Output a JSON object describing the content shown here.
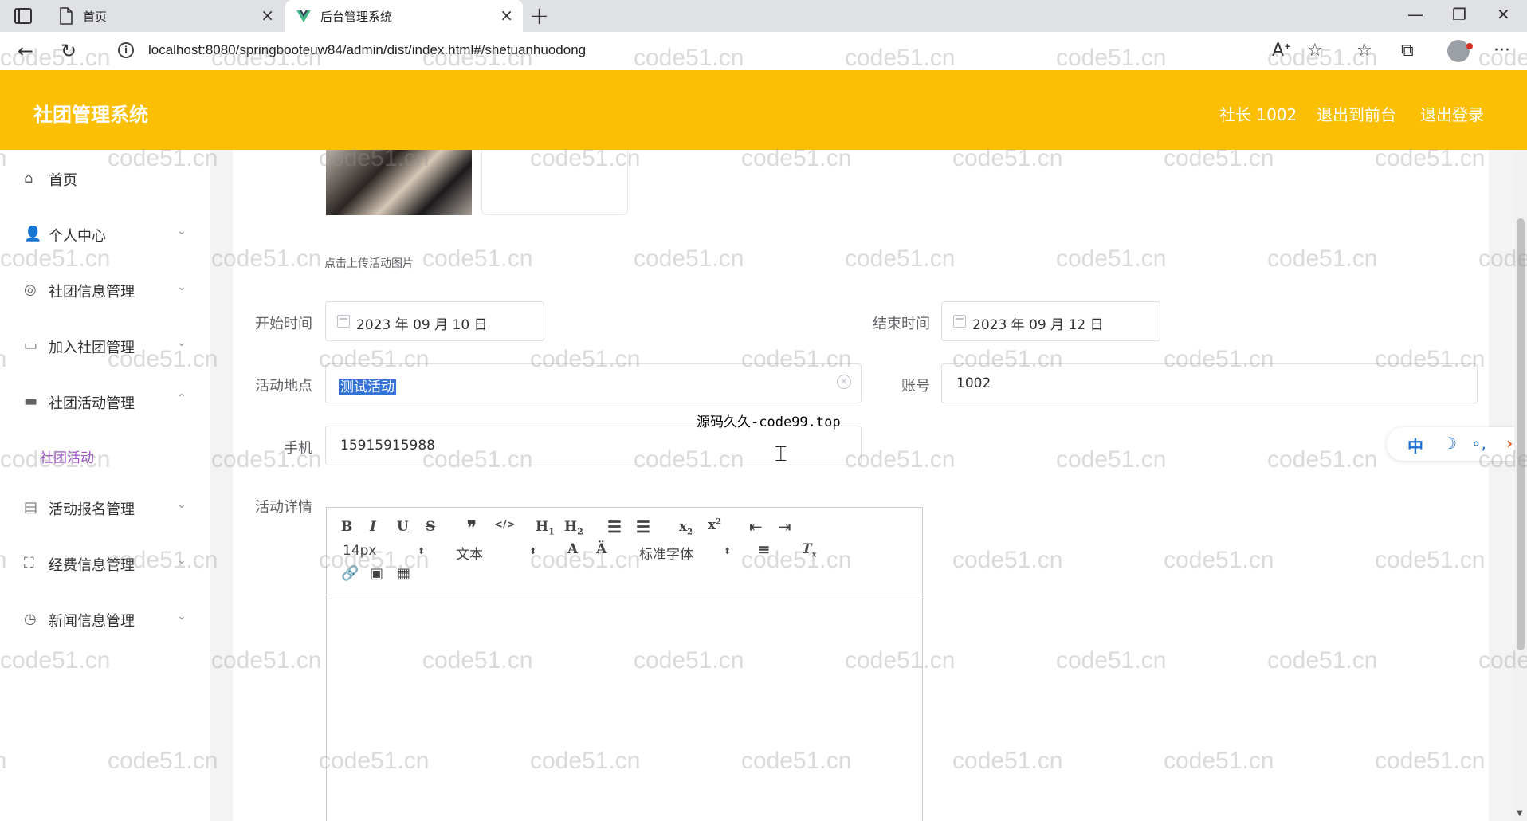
{
  "browser": {
    "tabs": [
      {
        "title": "首页",
        "active": false
      },
      {
        "title": "后台管理系统",
        "active": true
      }
    ],
    "url": "localhost:8080/springbooteuw84/admin/dist/index.html#/shetuanhuodong"
  },
  "header": {
    "title": "社团管理系统",
    "user": "社长 1002",
    "front_link": "退出到前台",
    "logout": "退出登录",
    "color": "#fbbf05"
  },
  "sidebar": {
    "items": [
      {
        "label": "首页",
        "icon": "home-icon"
      },
      {
        "label": "个人中心",
        "icon": "user-icon"
      },
      {
        "label": "社团信息管理",
        "icon": "globe-icon"
      },
      {
        "label": "加入社团管理",
        "icon": "chat-icon"
      },
      {
        "label": "社团活动管理",
        "icon": "ticket-icon"
      },
      {
        "label": "活动报名管理",
        "icon": "briefcase-icon"
      },
      {
        "label": "经费信息管理",
        "icon": "fullscreen-icon"
      },
      {
        "label": "新闻信息管理",
        "icon": "clock-icon"
      }
    ],
    "sub_active": "社团活动",
    "sub_color": "#9b4dca"
  },
  "form": {
    "upload_hint": "点击上传活动图片",
    "start_label": "开始时间",
    "start_value": "2023 年 09 月 10 日",
    "end_label": "结束时间",
    "end_value": "2023 年 09 月 12 日",
    "location_label": "活动地点",
    "location_value": "测试活动",
    "account_label": "账号",
    "account_value": "1002",
    "phone_label": "手机",
    "phone_value": "15915915988",
    "detail_label": "活动详情"
  },
  "editor": {
    "font_size": "14px",
    "block_type": "文本",
    "font_family": "标准字体"
  },
  "overlay": {
    "tooltip": "源码久久-code99.top",
    "watermark": "code51.cn"
  },
  "widget": {
    "lang": "中"
  }
}
